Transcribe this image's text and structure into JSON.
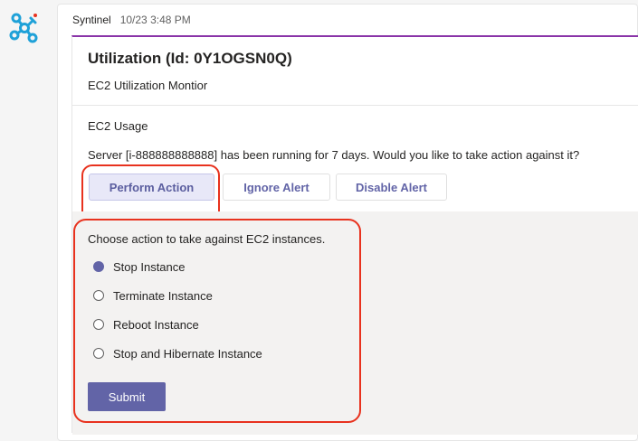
{
  "message": {
    "sender": "Syntinel",
    "timestamp": "10/23 3:48 PM"
  },
  "card": {
    "title": "Utilization (Id: 0Y1OGSN0Q)",
    "subtitle": "EC2 Utilization Montior",
    "section_label": "EC2 Usage",
    "alert_text": "Server [i-888888888888] has been running for 7 days. Would you like to take action against it?",
    "actions": {
      "perform": "Perform Action",
      "ignore": "Ignore Alert",
      "disable": "Disable Alert"
    }
  },
  "action_panel": {
    "prompt": "Choose action to take against EC2 instances.",
    "options": [
      {
        "label": "Stop Instance",
        "selected": true
      },
      {
        "label": "Terminate Instance",
        "selected": false
      },
      {
        "label": "Reboot Instance",
        "selected": false
      },
      {
        "label": "Stop and Hibernate Instance",
        "selected": false
      }
    ],
    "submit_label": "Submit"
  },
  "icons": {
    "avatar": "syntinel-logo-icon"
  },
  "colors": {
    "accent": "#6264a7",
    "card_top_border": "#8a34a8",
    "highlight": "#e8321e",
    "logo": "#1fa1d8"
  }
}
